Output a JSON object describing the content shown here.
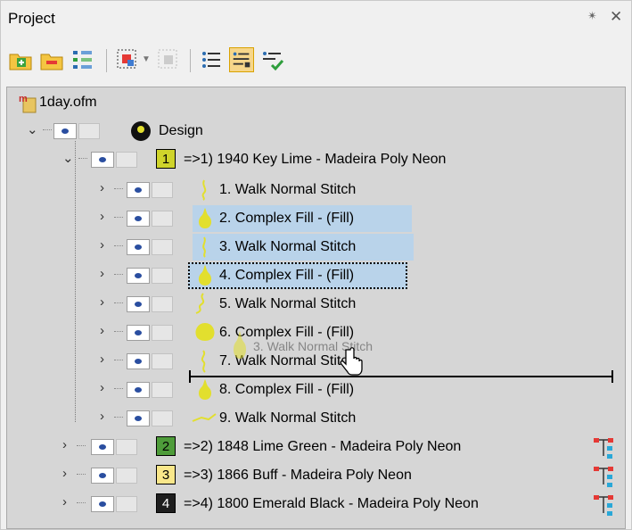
{
  "panel": {
    "title": "Project",
    "pin_glyph": "✴",
    "close_glyph": "✕"
  },
  "toolbar": {
    "icons": [
      "add-folder-icon",
      "open-folder-icon",
      "sort-layers-icon",
      "select-stitches-icon",
      "dropdown-arrow-icon",
      "select-disabled-icon",
      "list-view-icon",
      "details-view-icon",
      "check-view-icon"
    ]
  },
  "tree": {
    "file": "1day.ofm",
    "design": "Design",
    "colors": [
      {
        "num": "1",
        "label": "=>1) 1940 Key Lime - Madeira Poly Neon",
        "swatch": "#cfd42b",
        "numColor": "#000000"
      },
      {
        "num": "2",
        "label": "=>2) 1848 Lime Green - Madeira Poly Neon",
        "swatch": "#4e9c3a",
        "numColor": "#000000"
      },
      {
        "num": "3",
        "label": "=>3) 1866 Buff - Madeira Poly Neon",
        "swatch": "#f9e78a",
        "numColor": "#000000"
      },
      {
        "num": "4",
        "label": "=>4) 1800 Emerald Black - Madeira Poly Neon",
        "swatch": "#1e1e1e",
        "numColor": "#ffffff"
      }
    ],
    "objects": [
      "1. Walk Normal Stitch",
      "2. Complex Fill - (Fill)",
      "3. Walk Normal Stitch",
      "4. Complex Fill - (Fill)",
      "5. Walk Normal Stitch",
      "6. Complex Fill - (Fill)",
      "7. Walk Normal Stitch",
      "8. Complex Fill - (Fill)",
      "9. Walk Normal Stitch"
    ],
    "drag_ghost": "3. Walk Normal Stitch"
  },
  "colors": {
    "selection": "#b9d3ea",
    "thread": "#e2df2e"
  }
}
